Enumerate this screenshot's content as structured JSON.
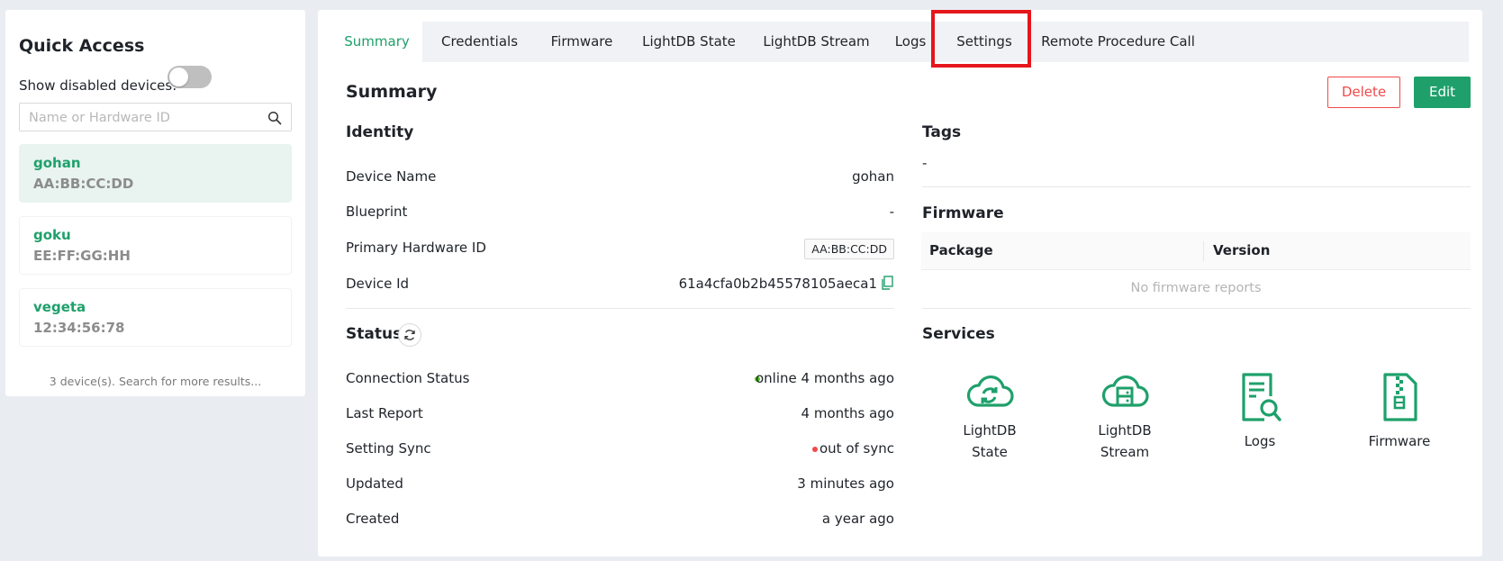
{
  "sidebar": {
    "title": "Quick Access",
    "show_disabled_label": "Show disabled devices:",
    "show_disabled": false,
    "search_placeholder": "Name or Hardware ID",
    "devices": [
      {
        "name": "gohan",
        "hardware_id": "AA:BB:CC:DD",
        "selected": true
      },
      {
        "name": "goku",
        "hardware_id": "EE:FF:GG:HH",
        "selected": false
      },
      {
        "name": "vegeta",
        "hardware_id": "12:34:56:78",
        "selected": false
      }
    ],
    "count_text": "3 device(s). Search for more results..."
  },
  "tabs": [
    {
      "label": "Summary",
      "active": true
    },
    {
      "label": "Credentials",
      "active": false
    },
    {
      "label": "Firmware",
      "active": false
    },
    {
      "label": "LightDB State",
      "active": false
    },
    {
      "label": "LightDB Stream",
      "active": false
    },
    {
      "label": "Logs",
      "active": false
    },
    {
      "label": "Settings",
      "active": false
    },
    {
      "label": "Remote Procedure Call",
      "active": false
    }
  ],
  "summary": {
    "title": "Summary",
    "delete_label": "Delete",
    "edit_label": "Edit",
    "identity": {
      "title": "Identity",
      "rows": [
        {
          "label": "Device Name",
          "value": "gohan"
        },
        {
          "label": "Blueprint",
          "value": "-"
        },
        {
          "label": "Primary Hardware ID",
          "value": "AA:BB:CC:DD"
        },
        {
          "label": "Device Id",
          "value": "61a4cfa0b2b45578105aeca1"
        }
      ]
    },
    "status": {
      "title": "Status",
      "rows": [
        {
          "label": "Connection Status",
          "value": "online 4 months ago"
        },
        {
          "label": "Last Report",
          "value": "4 months ago"
        },
        {
          "label": "Setting Sync",
          "value": "out of sync"
        },
        {
          "label": "Updated",
          "value": "3 minutes ago"
        },
        {
          "label": "Created",
          "value": "a year ago"
        }
      ]
    },
    "tags": {
      "title": "Tags",
      "value": "-"
    },
    "firmware": {
      "title": "Firmware",
      "columns": [
        "Package",
        "Version"
      ],
      "empty_text": "No firmware reports"
    },
    "services": {
      "title": "Services",
      "items": [
        {
          "label_line1": "LightDB",
          "label_line2": "State",
          "icon": "cloud-sync-icon"
        },
        {
          "label_line1": "LightDB",
          "label_line2": "Stream",
          "icon": "cloud-storage-icon"
        },
        {
          "label_line1": "Logs",
          "label_line2": "",
          "icon": "file-search-icon"
        },
        {
          "label_line1": "Firmware",
          "label_line2": "",
          "icon": "file-zip-icon"
        }
      ]
    }
  },
  "colors": {
    "accent": "#1fa06b",
    "danger": "#f04a4a",
    "online": "#52c41a",
    "highlight": "#e5161c"
  }
}
